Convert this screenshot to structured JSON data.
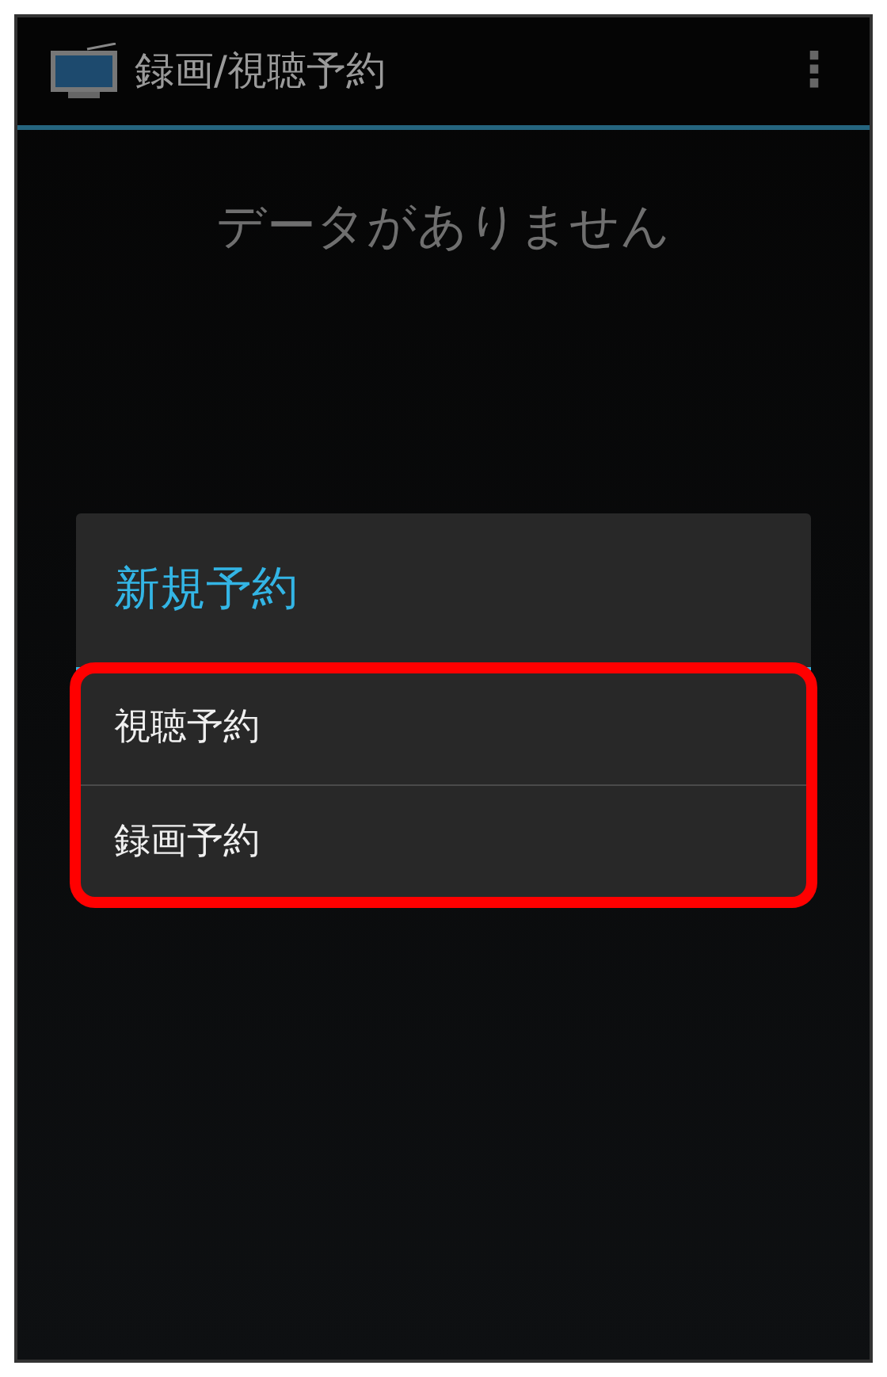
{
  "action_bar": {
    "title": "録画/視聴予約",
    "menu_icon": "⋮"
  },
  "empty_message": "データがありません",
  "dialog": {
    "title": "新規予約",
    "items": [
      {
        "label": "視聴予約"
      },
      {
        "label": "録画予約"
      }
    ],
    "highlighted": true
  }
}
